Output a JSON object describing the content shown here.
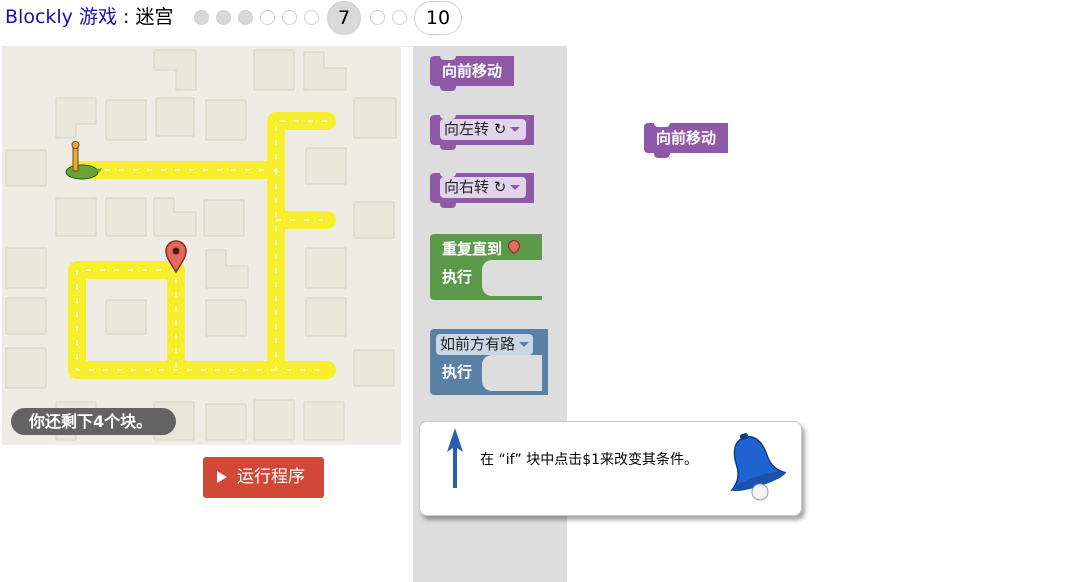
{
  "header": {
    "app_name": "Blockly 游戏",
    "separator": " : ",
    "game_name": "迷宫",
    "current_level": "7",
    "last_level": "10",
    "levels_done": [
      1,
      2,
      3,
      4,
      5,
      6
    ],
    "level_count": 10
  },
  "maze": {
    "blocks_left_text": "你还剩下4个块。",
    "path_color": "#f7ee2e",
    "background_color": "#efede3"
  },
  "run": {
    "label": "运行程序"
  },
  "toolbox": {
    "move_forward": "向前移动",
    "turn_left": "向左转 ↻",
    "turn_right": "向右转 ↻",
    "repeat_until": "重复直到",
    "do_label": "执行",
    "if_path": "如前方有路",
    "if_do_label": "执行"
  },
  "workspace": {
    "block_label": "向前移动"
  },
  "hint": {
    "text": "在 “if” 块中点击$1来改变其条件。"
  },
  "colors": {
    "movement_block": "#8e5aa8",
    "loop_block": "#5b9a4a",
    "logic_block": "#5b80a5",
    "run_button": "#d14836"
  }
}
